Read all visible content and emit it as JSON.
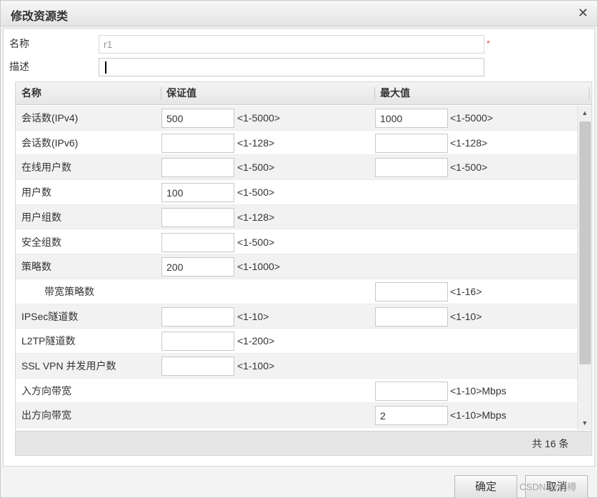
{
  "dialog": {
    "title": "修改资源类",
    "close_icon": "close-icon"
  },
  "form": {
    "name_label": "名称",
    "name_value": "r1",
    "required_mark": "*",
    "desc_label": "描述",
    "desc_value": ""
  },
  "grid": {
    "columns": [
      "名称",
      "保证值",
      "最大值"
    ],
    "rows": [
      {
        "name": "会话数(IPv4)",
        "guarantee": "500",
        "guarantee_range": "<1-5000>",
        "max": "1000",
        "max_range": "<1-5000>"
      },
      {
        "name": "会话数(IPv6)",
        "guarantee": "",
        "guarantee_range": "<1-128>",
        "max": "",
        "max_range": "<1-128>"
      },
      {
        "name": "在线用户数",
        "guarantee": "",
        "guarantee_range": "<1-500>",
        "max": "",
        "max_range": "<1-500>"
      },
      {
        "name": "用户数",
        "guarantee": "100",
        "guarantee_range": "<1-500>"
      },
      {
        "name": "用户组数",
        "guarantee": "",
        "guarantee_range": "<1-128>"
      },
      {
        "name": "安全组数",
        "guarantee": "",
        "guarantee_range": "<1-500>"
      },
      {
        "name": "策略数",
        "guarantee": "200",
        "guarantee_range": "<1-1000>"
      },
      {
        "name": "带宽策略数",
        "indent": true,
        "max": "",
        "max_range": "<1-16>"
      },
      {
        "name": "IPSec隧道数",
        "guarantee": "",
        "guarantee_range": "<1-10>",
        "max": "",
        "max_range": "<1-10>"
      },
      {
        "name": "L2TP隧道数",
        "guarantee": "",
        "guarantee_range": "<1-200>"
      },
      {
        "name": "SSL VPN 并发用户数",
        "guarantee": "",
        "guarantee_range": "<1-100>"
      },
      {
        "name": "入方向带宽",
        "max": "",
        "max_range": "<1-10>Mbps"
      },
      {
        "name": "出方向带宽",
        "max": "2",
        "max_range": "<1-10>Mbps"
      }
    ],
    "footer_total": "共 16 条"
  },
  "buttons": {
    "ok": "确定",
    "cancel": "取消"
  },
  "watermark": "CSDN @雨樽",
  "colors": {
    "required": "#e04b4b",
    "row_alt": "#f2f2f2"
  }
}
